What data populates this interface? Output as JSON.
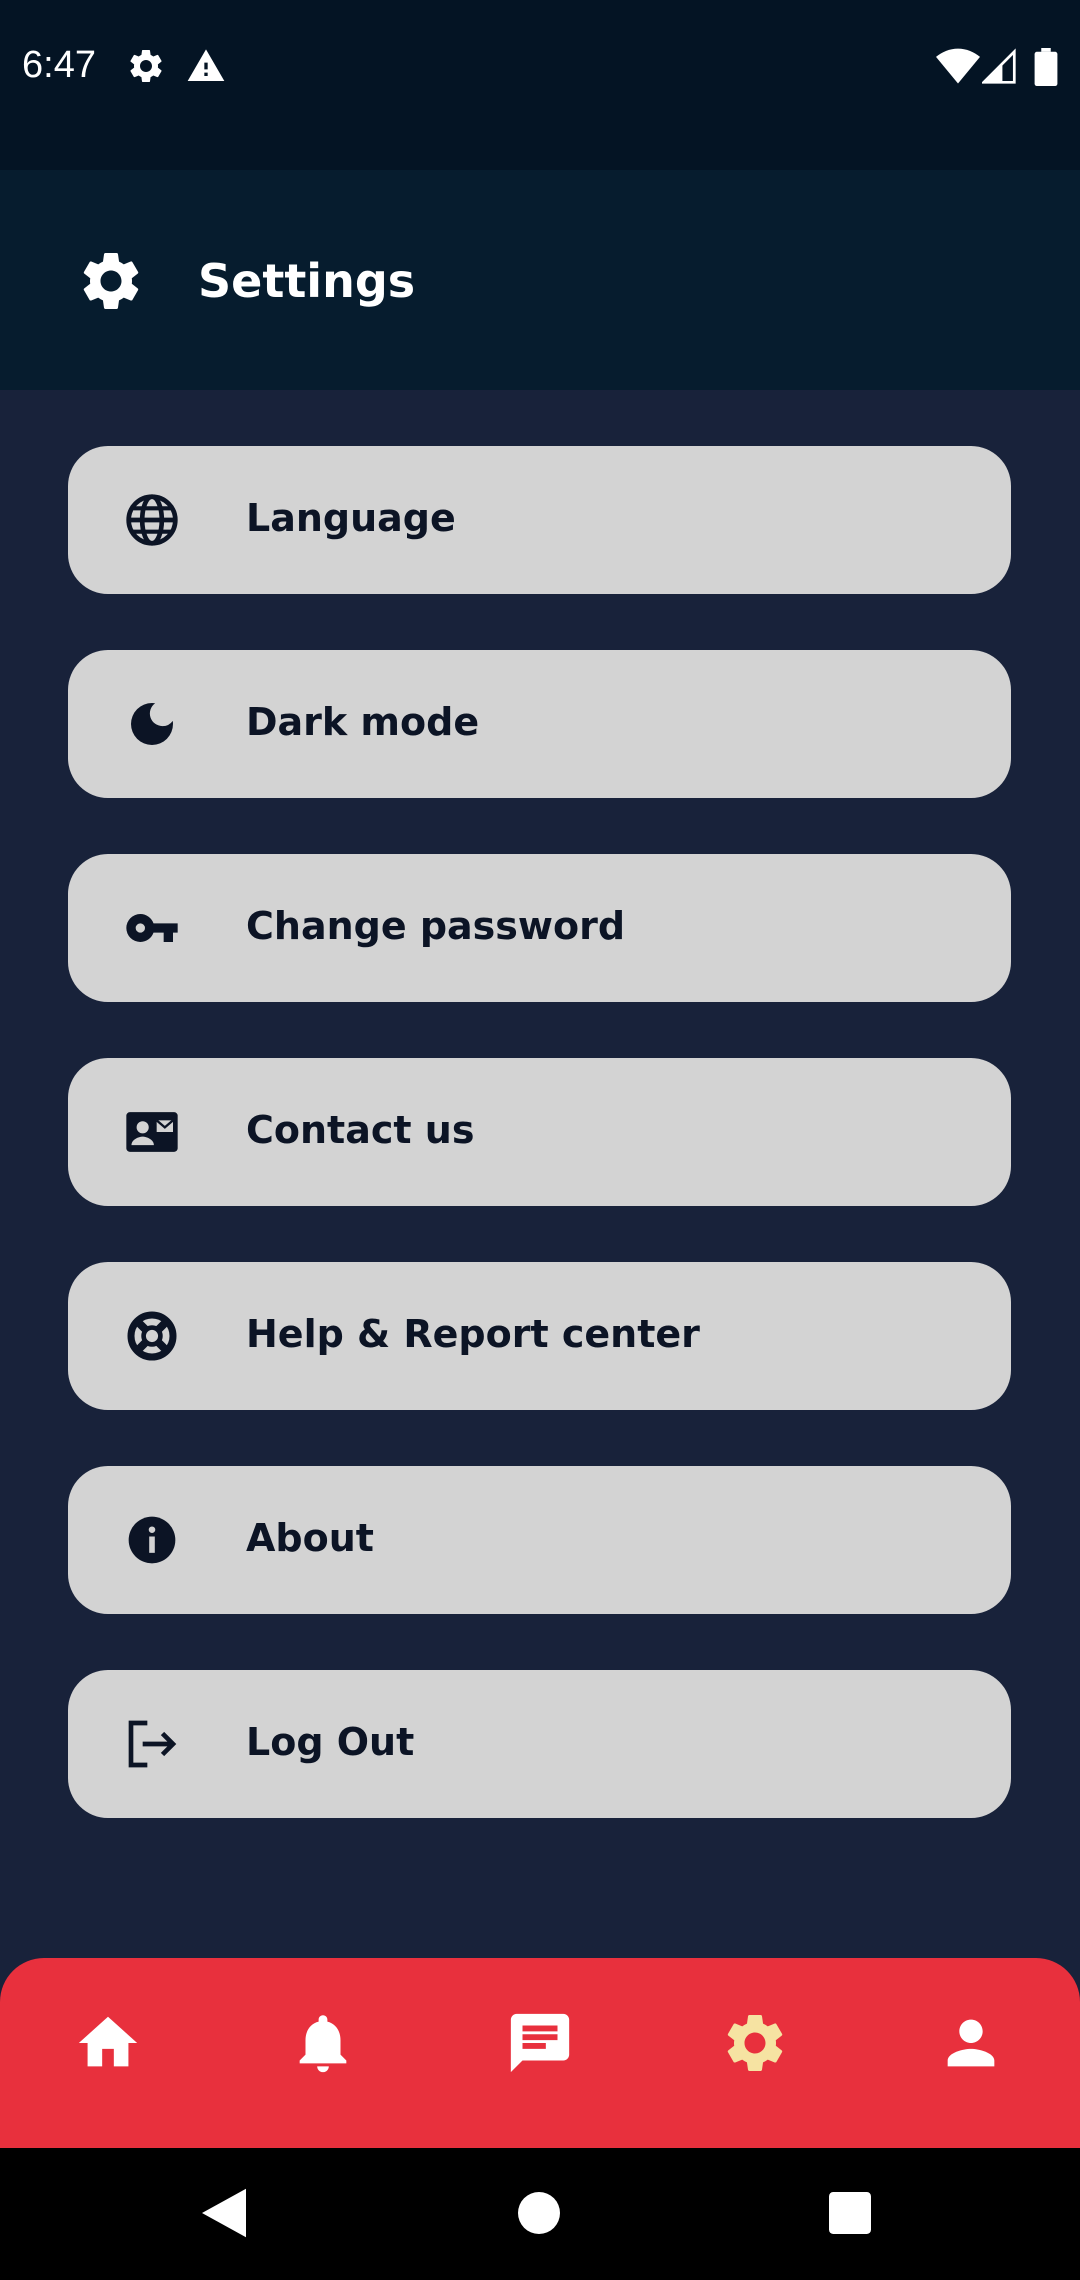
{
  "status_bar": {
    "time": "6:47",
    "left_icons": [
      "gear-icon",
      "warning-icon"
    ],
    "right_icons": [
      "wifi-icon",
      "cell-signal-icon",
      "battery-icon"
    ]
  },
  "header": {
    "icon": "gear-icon",
    "title": "Settings"
  },
  "menu": {
    "items": [
      {
        "icon": "globe-icon",
        "label": "Language"
      },
      {
        "icon": "moon-icon",
        "label": "Dark mode"
      },
      {
        "icon": "key-icon",
        "label": "Change password"
      },
      {
        "icon": "contact-card-icon",
        "label": "Contact us"
      },
      {
        "icon": "lifebuoy-icon",
        "label": "Help & Report center"
      },
      {
        "icon": "info-icon",
        "label": "About"
      },
      {
        "icon": "logout-icon",
        "label": "Log Out"
      }
    ]
  },
  "bottom_nav": {
    "items": [
      {
        "icon": "home-icon",
        "active": false
      },
      {
        "icon": "bell-icon",
        "active": false
      },
      {
        "icon": "chat-icon",
        "active": false
      },
      {
        "icon": "gear-icon",
        "active": true
      },
      {
        "icon": "person-icon",
        "active": false
      }
    ],
    "active_color": "#f6e3a2",
    "inactive_color": "#ffffff",
    "background": "#e8303d"
  },
  "system_nav": {
    "items": [
      "back-icon",
      "home-circle-icon",
      "recents-icon"
    ]
  },
  "colors": {
    "background": "#18223a",
    "status_bar": "#041424",
    "header": "#061c2e",
    "menu_item": "#d3d3d3",
    "menu_text": "#0c1425"
  }
}
